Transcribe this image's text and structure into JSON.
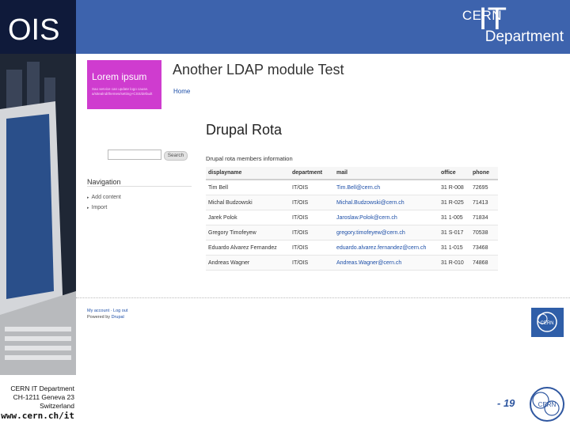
{
  "header": {
    "title": "OIS",
    "org_cern": "CERN",
    "org_it": "IT",
    "org_dept": "Department"
  },
  "side": {
    "address": [
      "CERN IT Department",
      "CH-1211 Geneva 23",
      "Switzerland"
    ],
    "web": "www.cern.ch/it"
  },
  "site": {
    "banner_title": "Lorem ipsum",
    "banner_sub": "Sao service can update logo cause. a/sitealnd/themes/setting+CSS/default",
    "name": "Another LDAP module Test",
    "home": "Home"
  },
  "search": {
    "button": "Search",
    "value": ""
  },
  "nav": {
    "heading": "Navigation",
    "items": [
      "Add content",
      "Import"
    ]
  },
  "page": {
    "title": "Drupal Rota",
    "caption": "Drupal rota members information",
    "columns": [
      "displayname",
      "department",
      "mail",
      "office",
      "phone"
    ],
    "rows": [
      [
        "Tim Bell",
        "IT/OIS",
        "Tim.Bell@cern.ch",
        "31 R-008",
        "72695"
      ],
      [
        "Michal Budzowski",
        "IT/OIS",
        "Michal.Budzowski@cern.ch",
        "31 R-025",
        "71413"
      ],
      [
        "Jarek Polok",
        "IT/OIS",
        "Jaroslaw.Polok@cern.ch",
        "31 1-005",
        "71834"
      ],
      [
        "Gregory Timofeyew",
        "IT/OIS",
        "gregory.timofeyew@cern.ch",
        "31 S-017",
        "70538"
      ],
      [
        "Eduardo Alvarez Fernandez",
        "IT/OIS",
        "eduardo.alvarez.fernandez@cern.ch",
        "31 1-015",
        "73468"
      ],
      [
        "Andreas Wagner",
        "IT/OIS",
        "Andreas.Wagner@cern.ch",
        "31 R-010",
        "74868"
      ]
    ]
  },
  "footer": {
    "links": "My account  ·  Log out",
    "powered_prefix": "Powered by ",
    "powered_brand": "Drupal"
  },
  "slide": {
    "page_number": "- 19",
    "badge_text": "CERN"
  },
  "colors": {
    "top_bar": "#3d63ad",
    "banner": "#cf3ccf",
    "link": "#1d4fa8"
  }
}
